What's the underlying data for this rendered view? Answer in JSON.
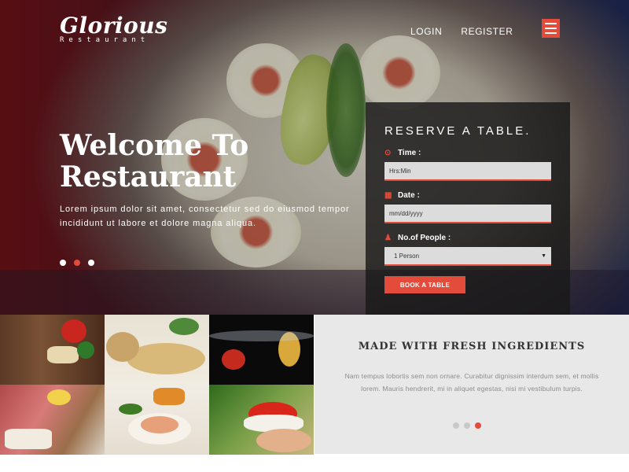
{
  "brand": {
    "name": "Glorious",
    "tagline": "Restaurant"
  },
  "nav": {
    "login": "LOGIN",
    "register": "REGISTER",
    "menu_icon": "hamburger-icon"
  },
  "hero": {
    "title_line1": "Welcome To",
    "title_line2": "Restaurant",
    "text": "Lorem ipsum dolor sit amet, consectetur sed do eiusmod tempor incididunt ut labore et dolore magna aliqua.",
    "slides": 3,
    "active_slide": 2
  },
  "reserve": {
    "title": "RESERVE A TABLE.",
    "time_label": "Time :",
    "time_value": "Hrs:Min",
    "date_label": "Date :",
    "date_value": "mm/dd/yyyy",
    "people_label": "No.of People :",
    "people_value": "1 Person",
    "button": "BOOK A TABLE"
  },
  "ingredients": {
    "title": "MADE WITH FRESH INGREDIENTS",
    "text": "Nam tempus lobortis sem non ornare. Curabitur dignissim interdum sem, et mollis lorem. Mauris hendrerit, mi in aliquet egestas, nisi mi vestibulum turpis.",
    "active_dot": 3
  },
  "colors": {
    "accent": "#e34b3a",
    "panel": "#191919",
    "light_bg": "#e8e8e8"
  }
}
